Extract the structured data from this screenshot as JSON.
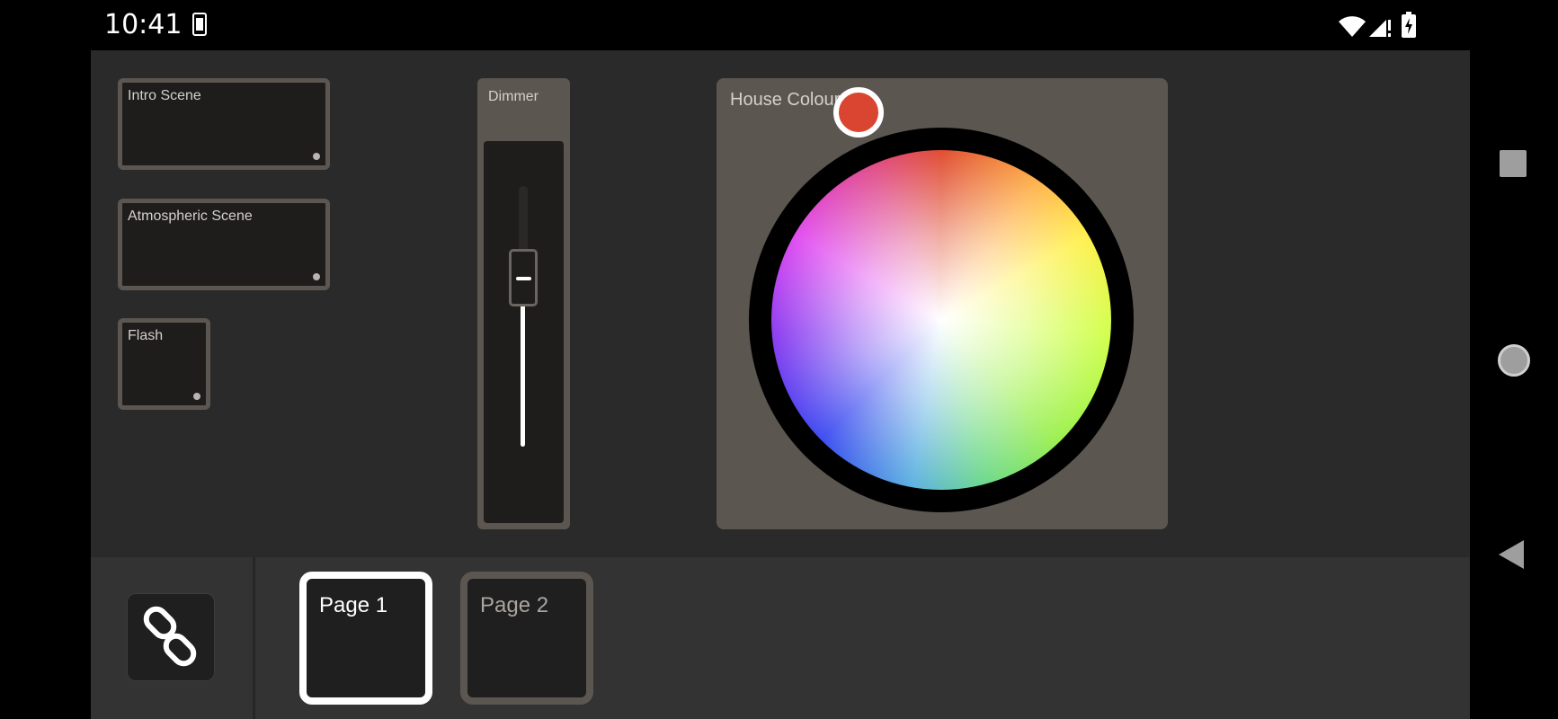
{
  "status_bar": {
    "time": "10:41",
    "icons": [
      "sim-card-icon",
      "wifi-icon",
      "cell-signal-icon",
      "battery-charging-icon"
    ]
  },
  "scenes": [
    {
      "label": "Intro Scene"
    },
    {
      "label": "Atmospheric Scene"
    },
    {
      "label": "Flash"
    }
  ],
  "dimmer": {
    "label": "Dimmer",
    "level": 0.68
  },
  "colour_picker": {
    "label": "House Colours",
    "selected_color": "#d94530"
  },
  "bottom_bar": {
    "link_icon": "link-icon",
    "pages": [
      {
        "label": "Page 1",
        "active": true
      },
      {
        "label": "Page 2",
        "active": false
      }
    ]
  },
  "nav_bar": {
    "icons": [
      "recents-icon",
      "home-icon",
      "back-icon"
    ]
  },
  "colors": {
    "panel": "#5c5651",
    "background": "#2a2a2a",
    "bottom_bar": "#333333",
    "active_page_border": "#ffffff"
  }
}
